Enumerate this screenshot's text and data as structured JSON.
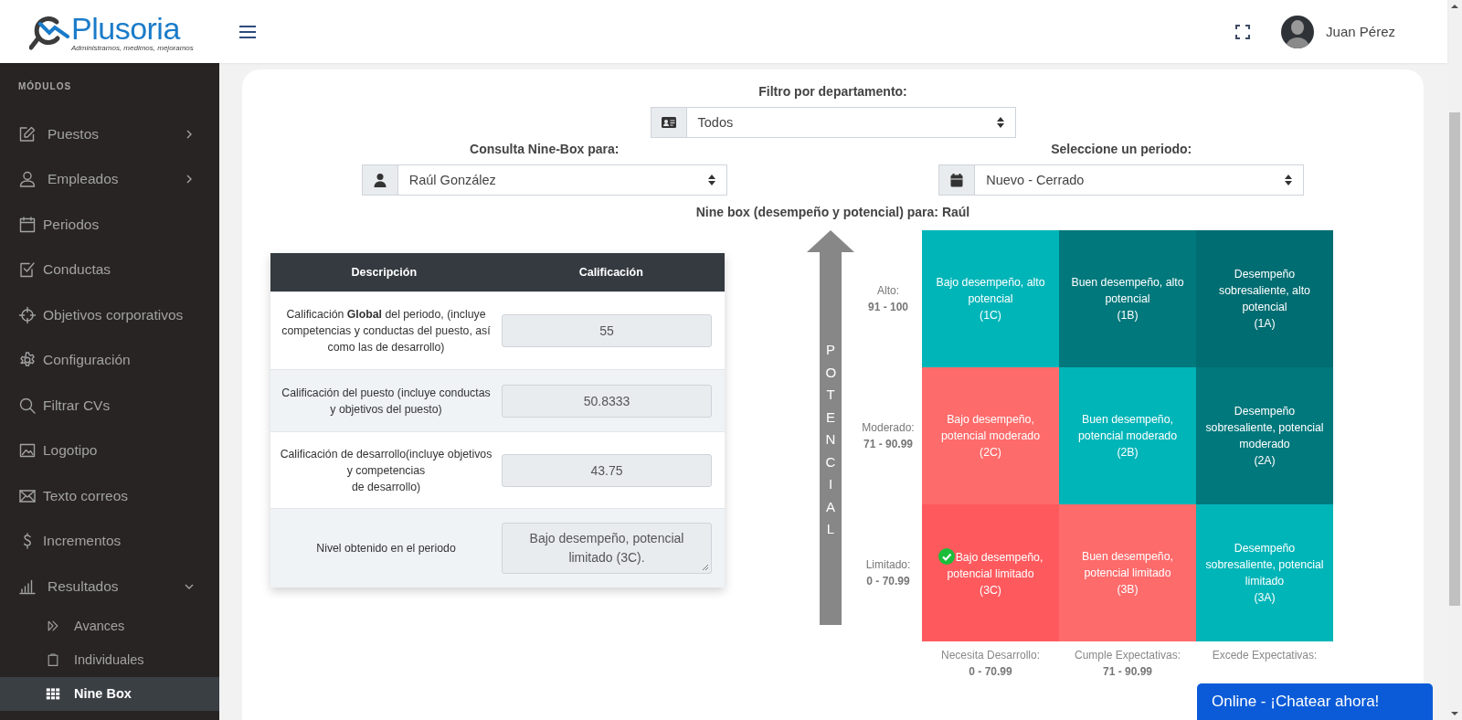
{
  "header": {
    "logo": {
      "name": "Plusoria",
      "tagline": "Administramos, medimos, mejoramos"
    },
    "user": {
      "name": "Juan Pérez"
    }
  },
  "sidebar": {
    "section_title": "MÓDULOS",
    "items": [
      {
        "label": "Puestos",
        "kind": "group",
        "expanded": false,
        "selected": false
      },
      {
        "label": "Empleados",
        "kind": "group",
        "expanded": false,
        "selected": false
      },
      {
        "label": "Periodos",
        "kind": "link",
        "selected": false
      },
      {
        "label": "Conductas",
        "kind": "link",
        "selected": false
      },
      {
        "label": "Objetivos corporativos",
        "kind": "link",
        "selected": false
      },
      {
        "label": "Configuración",
        "kind": "link",
        "selected": false
      },
      {
        "label": "Filtrar CVs",
        "kind": "link",
        "selected": false
      },
      {
        "label": "Logotipo",
        "kind": "link",
        "selected": false
      },
      {
        "label": "Texto correos",
        "kind": "link",
        "selected": false
      },
      {
        "label": "Incrementos",
        "kind": "link",
        "selected": false
      },
      {
        "label": "Resultados",
        "kind": "group",
        "expanded": true,
        "selected": false,
        "children": [
          {
            "label": "Avances",
            "selected": false
          },
          {
            "label": "Individuales",
            "selected": false
          },
          {
            "label": "Nine Box",
            "selected": true
          }
        ]
      }
    ]
  },
  "filters": {
    "department": {
      "label": "Filtro por departamento:",
      "value": "Todos"
    },
    "employee": {
      "label": "Consulta Nine-Box para:",
      "value": "Raúl González"
    },
    "period": {
      "label": "Seleccione un periodo:",
      "value": "Nuevo - Cerrado"
    }
  },
  "nine_box_title": "Nine box (desempeño y potencial) para: Raúl",
  "table": {
    "columns": [
      "Descripción",
      "Calificación"
    ],
    "rows": [
      {
        "description": "Calificación **Global** del periodo, (incluye competencias y conductas del puesto, así como las de desarrollo)",
        "value": "55",
        "kind": "input"
      },
      {
        "description": "Calificación del puesto (incluye conductas y objetivos del puesto)",
        "value": "50.8333",
        "kind": "input"
      },
      {
        "description": "Calificación de desarrollo(incluye objetivos y competencias\nde desarrollo)",
        "value": "43.75",
        "kind": "input"
      },
      {
        "description": "Nivel obtenido en el periodo",
        "value": "Bajo desempeño, potencial limitado (3C).",
        "kind": "textarea"
      }
    ]
  },
  "nine_box": {
    "axis_label": "POTENCIAL",
    "rows": [
      {
        "label": "Alto:",
        "range": "91 - 100"
      },
      {
        "label": "Moderado:",
        "range": "71 - 90.99"
      },
      {
        "label": "Limitado:",
        "range": "0 - 70.99"
      }
    ],
    "columns": [
      {
        "label": "Necesita Desarrollo:",
        "range": "0 - 70.99"
      },
      {
        "label": "Cumple Expectativas:",
        "range": "71 - 90.99"
      },
      {
        "label": "Excede Expectativas:"
      }
    ],
    "cells": [
      {
        "text": "Bajo desempeño, alto potencial",
        "code": "(1C)",
        "color": "#00b5b8",
        "selected": false
      },
      {
        "text": "Buen desempeño, alto potencial",
        "code": "(1B)",
        "color": "#00787c",
        "selected": false
      },
      {
        "text": "Desempeño sobresaliente, alto potencial",
        "code": "(1A)",
        "color": "#006d72",
        "selected": false
      },
      {
        "text": "Bajo desempeño, potencial moderado",
        "code": "(2C)",
        "color": "#fe6b6b",
        "selected": false
      },
      {
        "text": "Buen desempeño, potencial moderado",
        "code": "(2B)",
        "color": "#00b5b8",
        "selected": false
      },
      {
        "text": "Desempeño sobresaliente, potencial moderado",
        "code": "(2A)",
        "color": "#00787c",
        "selected": false
      },
      {
        "text": "Bajo desempeño, potencial limitado",
        "code": "(3C)",
        "color": "#fe5a5e",
        "selected": true
      },
      {
        "text": "Buen desempeño, potencial limitado",
        "code": "(3B)",
        "color": "#fe6b6b",
        "selected": false
      },
      {
        "text": "Desempeño sobresaliente, potencial limitado",
        "code": "(3A)",
        "color": "#00b5b8",
        "selected": false
      }
    ]
  },
  "chat": {
    "label": "Online - ¡Chatear ahora!"
  }
}
